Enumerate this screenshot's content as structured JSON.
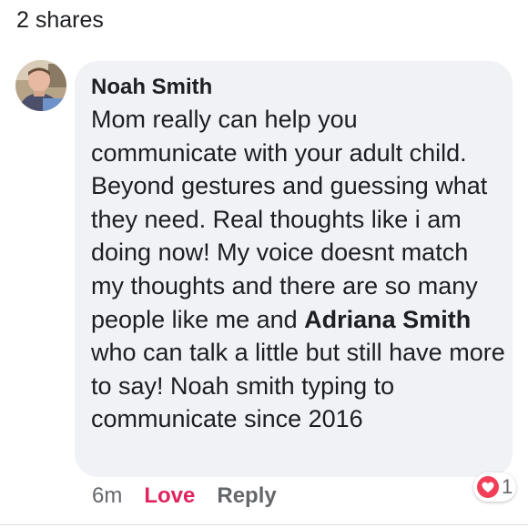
{
  "shares_label": "2 shares",
  "comment": {
    "author": "Noah Smith",
    "text_parts": [
      "Mom really can help you communicate with your adult child. Beyond gestures and guessing what they need. Real thoughts like i am doing now! My voice doesnt match my thoughts and there are so many people like me and ",
      "Adriana Smith",
      " who can talk a little but still have more to say! Noah smith typing to communicate since 2016"
    ],
    "timestamp": "6m",
    "love_label": "Love",
    "reply_label": "Reply",
    "reaction_count": "1",
    "reaction_icon": "heart-icon"
  },
  "colors": {
    "bubble": "#f0f2f5",
    "love": "#e0245e",
    "meta": "#65676b",
    "heart": "#f33e58"
  }
}
